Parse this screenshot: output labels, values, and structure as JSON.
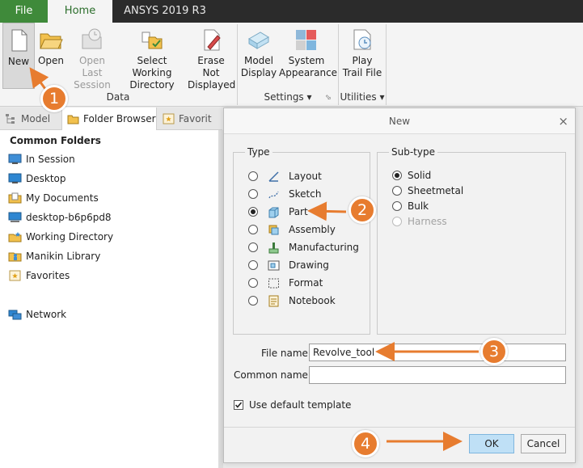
{
  "tabs": {
    "file": "File",
    "home": "Home",
    "product": "ANSYS 2019 R3"
  },
  "ribbon": {
    "new": "New",
    "open": "Open",
    "open_last_session": "Open Last Session",
    "select_working_directory": "Select Working Directory",
    "erase_not_displayed": "Erase Not Displayed",
    "model_display": "Model Display",
    "system_appearance": "System Appearance",
    "play_trail_file": "Play Trail File",
    "group_data": "Data",
    "group_settings": "Settings ▾",
    "group_utilities": "Utilities ▾"
  },
  "left_panel": {
    "tabs": [
      "Model",
      "Folder Browser",
      "Favorit"
    ],
    "section_title": "Common Folders",
    "folders": [
      {
        "label": "In Session",
        "icon": "session-icon"
      },
      {
        "label": "Desktop",
        "icon": "desktop-icon"
      },
      {
        "label": "My Documents",
        "icon": "documents-icon"
      },
      {
        "label": "desktop-b6p6pd8",
        "icon": "computer-icon"
      },
      {
        "label": "Working Directory",
        "icon": "working-directory-icon"
      },
      {
        "label": "Manikin Library",
        "icon": "library-icon"
      },
      {
        "label": "Favorites",
        "icon": "favorites-icon"
      }
    ],
    "network": "Network"
  },
  "dialog": {
    "title": "New",
    "close": "×",
    "type_legend": "Type",
    "types": [
      "Layout",
      "Sketch",
      "Part",
      "Assembly",
      "Manufacturing",
      "Drawing",
      "Format",
      "Notebook"
    ],
    "selected_type": "Part",
    "subtype_legend": "Sub-type",
    "subtypes": [
      "Solid",
      "Sheetmetal",
      "Bulk",
      "Harness"
    ],
    "selected_subtype": "Solid",
    "file_name_label": "File name:",
    "file_name_value": "Revolve_tool",
    "common_name_label": "Common name:",
    "common_name_value": "",
    "use_default_template": "Use default template",
    "ok": "OK",
    "cancel": "Cancel"
  },
  "annotations": [
    "1",
    "2",
    "3",
    "4"
  ],
  "colors": {
    "file_tab": "#3f8a3a",
    "annotation": "#e77c2f",
    "ok_button": "#bfe0f6"
  }
}
